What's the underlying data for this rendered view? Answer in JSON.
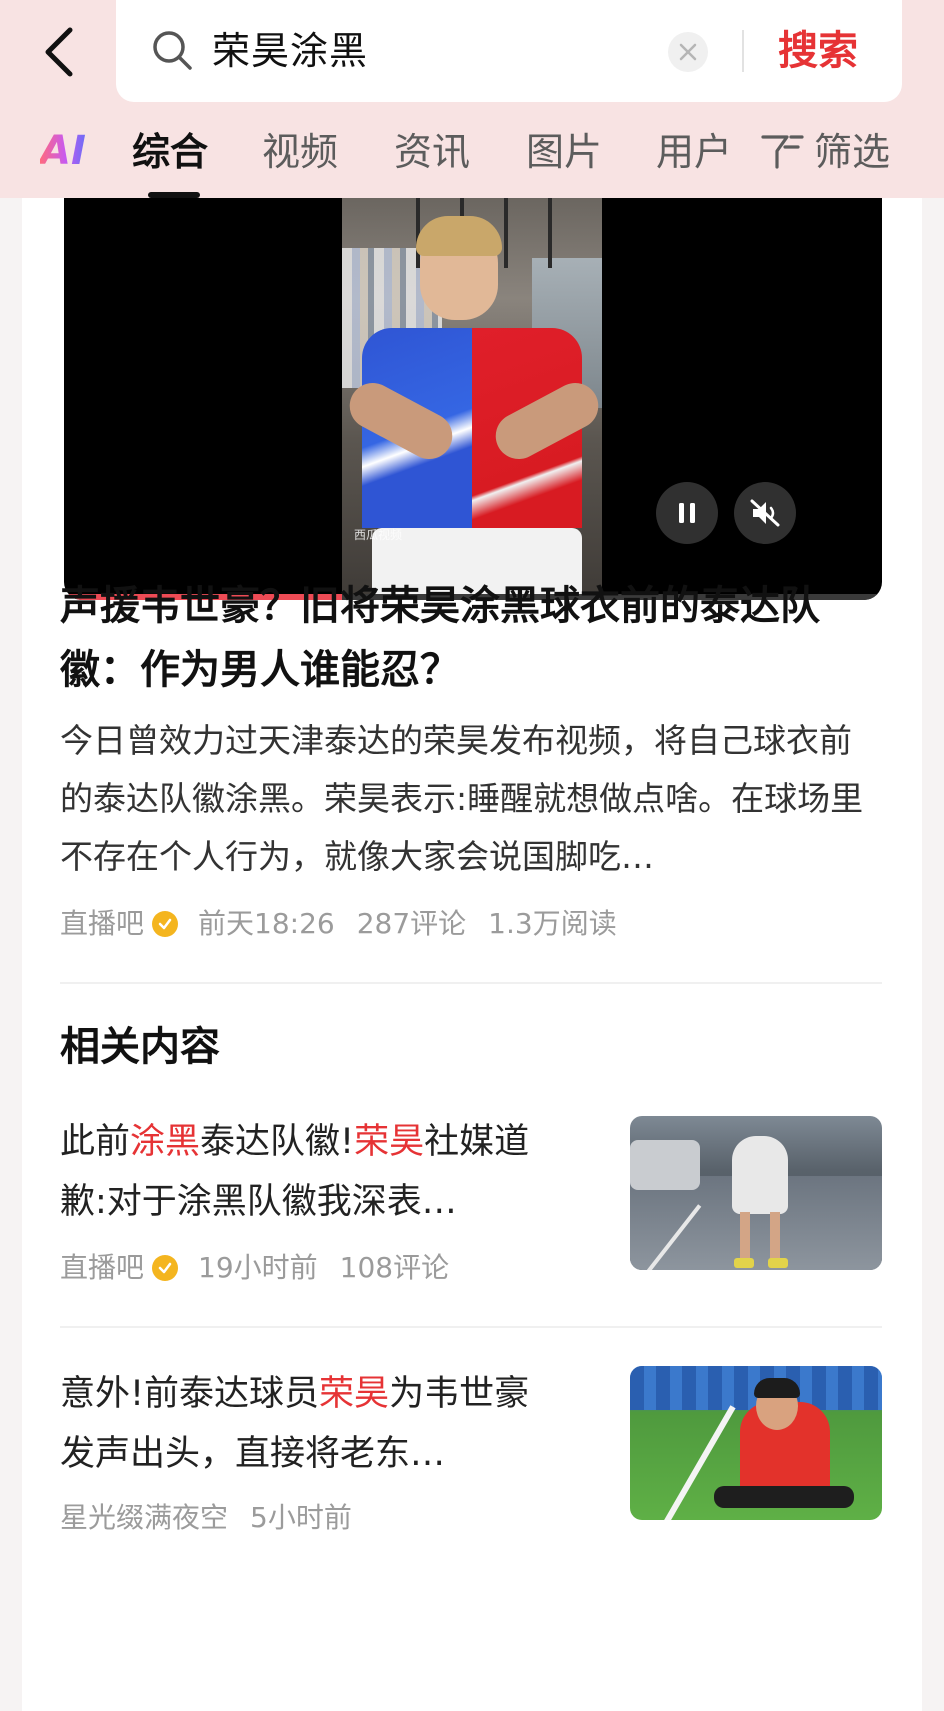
{
  "header": {
    "search_query": "荣昊涂黑",
    "search_button": "搜索"
  },
  "tabs": {
    "ai_label": "AI",
    "items": [
      {
        "label": "综合",
        "active": true
      },
      {
        "label": "视频",
        "active": false
      },
      {
        "label": "资讯",
        "active": false
      },
      {
        "label": "图片",
        "active": false
      },
      {
        "label": "用户",
        "active": false
      }
    ],
    "filter_label": "筛选"
  },
  "video": {
    "watermark": "西瓜视频",
    "progress": 0.34
  },
  "article": {
    "title": "声援韦世豪？旧将荣昊涂黑球衣前的泰达队徽：作为男人谁能忍？",
    "summary": "今日曾效力过天津泰达的荣昊发布视频，将自己球衣前的泰达队徽涂黑。荣昊表示:睡醒就想做点啥。在球场里不存在个人行为，就像大家会说国脚吃…",
    "source": "直播吧",
    "time": "前天18:26",
    "comments": "287评论",
    "reads": "1.3万阅读"
  },
  "related": {
    "section_title": "相关内容",
    "items": [
      {
        "title_parts": [
          "此前",
          "涂黑",
          "泰达队徽!",
          "荣昊",
          "社媒道歉:对于涂黑队徽我深表…"
        ],
        "source": "直播吧",
        "time": "19小时前",
        "comments": "108评论"
      },
      {
        "title_parts": [
          "意外!前泰达球员",
          "荣昊",
          "为韦世豪发声出头，直接将老东…"
        ],
        "source": "星光缀满夜空",
        "time": "5小时前"
      }
    ]
  },
  "colors": {
    "accent": "#e63335",
    "header_bg": "#f8e3e3",
    "verified_badge": "#f4b51f"
  }
}
